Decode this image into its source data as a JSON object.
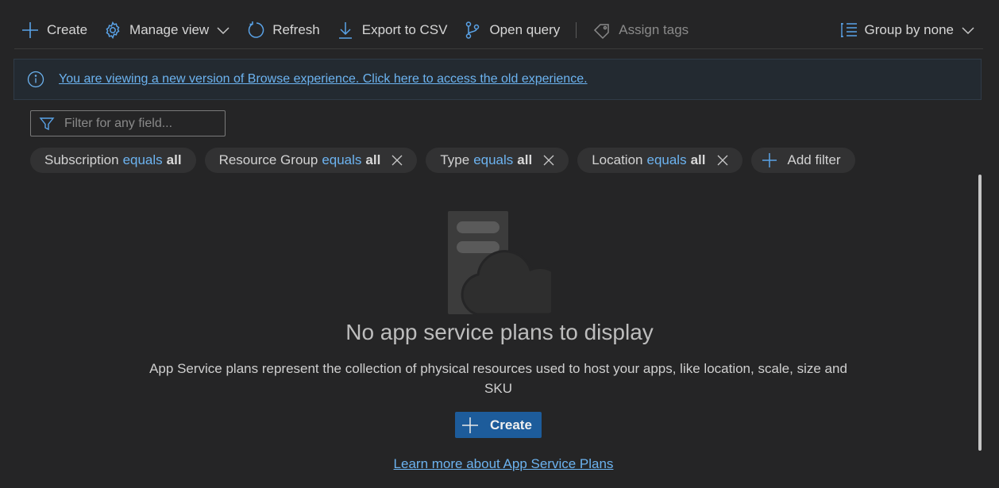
{
  "toolbar": {
    "create_label": "Create",
    "manage_view_label": "Manage view",
    "refresh_label": "Refresh",
    "export_label": "Export to CSV",
    "open_query_label": "Open query",
    "assign_tags_label": "Assign tags",
    "group_by_label": "Group by none"
  },
  "info_bar": {
    "message": "You are viewing a new version of Browse experience. Click here to access the old experience."
  },
  "filter": {
    "placeholder": "Filter for any field..."
  },
  "filter_pills": [
    {
      "field": "Subscription",
      "op": "equals",
      "value": "all"
    },
    {
      "field": "Resource Group",
      "op": "equals",
      "value": "all"
    },
    {
      "field": "Type",
      "op": "equals",
      "value": "all"
    },
    {
      "field": "Location",
      "op": "equals",
      "value": "all"
    }
  ],
  "add_filter_label": "Add filter",
  "empty_state": {
    "title": "No app service plans to display",
    "description": "App Service plans represent the collection of physical resources used to host your apps, like location, scale, size and SKU",
    "create_label": "Create",
    "learn_more_label": "Learn more about App Service Plans"
  },
  "colors": {
    "background": "#252526",
    "accent_blue": "#6cb3f0",
    "primary_button": "#1d5c9b",
    "info_bar_bg": "#232a31"
  }
}
